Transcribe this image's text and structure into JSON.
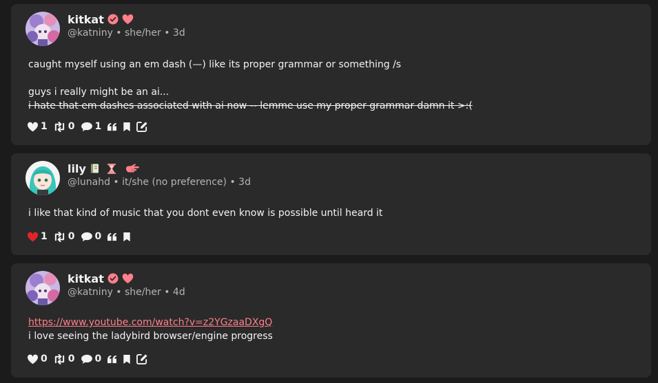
{
  "colors": {
    "background": "#1b1b1b",
    "card": "#2a2a2a",
    "accent": "#ff7f8a",
    "liked": "#e0242c",
    "text": "#f3f3f3",
    "muted": "#b5b5b5"
  },
  "posts": [
    {
      "display_name": "kitkat",
      "meta": "@katniny • she/her • 3d",
      "badges": [
        "verified-check-icon",
        "heart-badge-icon"
      ],
      "lines": [
        "caught myself using an em dash (—) like its proper grammar or something /s",
        "guys i really might be an ai...",
        "i hate that em dashes associated with ai now -- lemme use my proper grammar damn it >:("
      ],
      "likes": "1",
      "reposts": "0",
      "replies": "1",
      "liked": false,
      "has_edit": true
    },
    {
      "display_name": "lily",
      "meta": "@lunahd • it/she (no preference) • 3d",
      "badges": [
        "book-emoji-icon",
        "hourglass-emoji-icon",
        "pointing-hand-emoji-icon"
      ],
      "lines": [
        "i like that kind of music that you dont even know is possible until heard it"
      ],
      "likes": "1",
      "reposts": "0",
      "replies": "0",
      "liked": true,
      "has_edit": false
    },
    {
      "display_name": "kitkat",
      "meta": "@katniny • she/her • 4d",
      "badges": [
        "verified-check-icon",
        "heart-badge-icon"
      ],
      "link": "https://www.youtube.com/watch?v=z2YGzaaDXgQ",
      "lines": [
        "i love seeing the ladybird browser/engine progress"
      ],
      "likes": "0",
      "reposts": "0",
      "replies": "0",
      "liked": false,
      "has_edit": true
    }
  ]
}
